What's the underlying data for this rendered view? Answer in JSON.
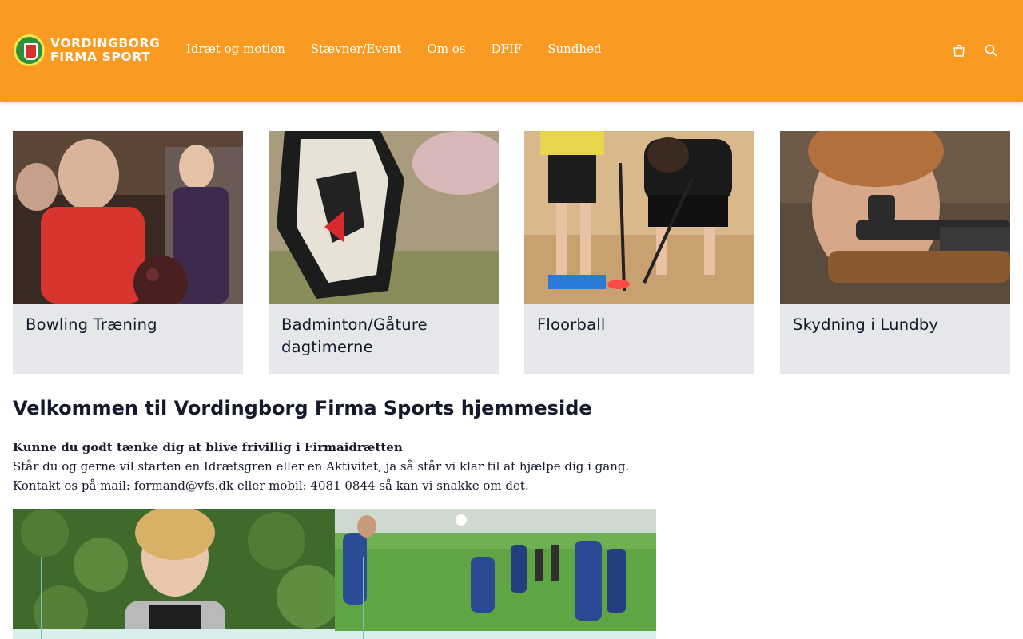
{
  "header": {
    "logo_line1": "VORDINGBORG",
    "logo_line2": "FIRMA SPORT",
    "nav": [
      "Idræt og motion",
      "Stævner/Event",
      "Om os",
      "DFIF",
      "Sundhed"
    ],
    "icons": [
      "shopping-bag-icon",
      "search-icon"
    ],
    "background": "#f99a22"
  },
  "cards": [
    {
      "title": "Bowling Træning"
    },
    {
      "title": "Badminton/Gåture dagtimerne"
    },
    {
      "title": "Floorball"
    },
    {
      "title": "Skydning i Lundby"
    }
  ],
  "welcome": {
    "title": "Velkommen til Vordingborg Firma Sports hjemmeside",
    "lead": "Kunne du godt tænke dig at blive frivillig i Firmaidrætten",
    "line2": "Står du og gerne vil starten en Idrætsgren eller en Aktivitet, ja så står vi klar til at hjælpe dig i gang.",
    "line3": "Kontakt os på mail: formand@vfs.dk eller mobil: 4081 0844 så kan vi snakke om det."
  },
  "colors": {
    "accent": "#f99a22",
    "card_bg": "#e6e7ea",
    "text": "#15192b"
  }
}
